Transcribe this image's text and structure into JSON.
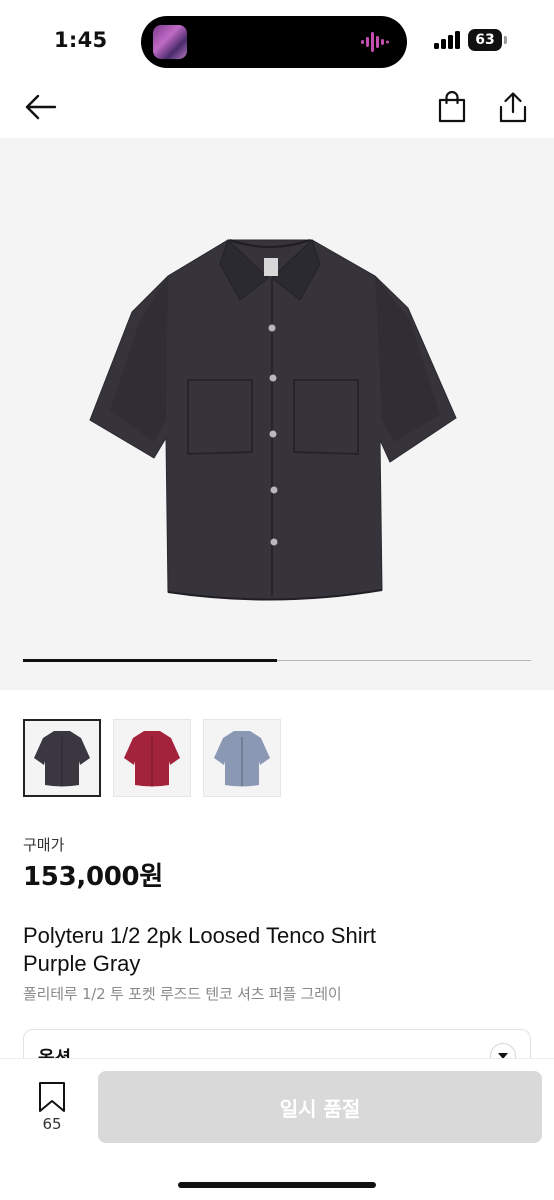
{
  "status_bar": {
    "time": "1:45",
    "battery": "63"
  },
  "nav": {
    "back_icon": "arrow-left-icon",
    "bag_icon": "shopping-bag-icon",
    "share_icon": "share-icon"
  },
  "gallery": {
    "image": "dark purple-gray short sleeve shirt with two chest pockets",
    "progress": 0.5
  },
  "thumbnails": [
    {
      "color": "#3a3740",
      "selected": true
    },
    {
      "color": "#a3233c",
      "selected": false
    },
    {
      "color": "#8a98b4",
      "selected": false
    }
  ],
  "price": {
    "label": "구매가",
    "value": "153,000원"
  },
  "product": {
    "title_line1": "Polyteru 1/2 2pk Loosed Tenco Shirt",
    "title_line2": "Purple Gray",
    "subtitle": "폴리테루 1/2 투 포켓 루즈드 텐코 셔츠 퍼플 그레이"
  },
  "option": {
    "label": "옵션"
  },
  "bottom": {
    "wishlist_count": "65",
    "button_label": "일시 품절"
  },
  "colors": {
    "disabled_button": "#d9d9d9",
    "gallery_bg": "#f4f4f4"
  }
}
